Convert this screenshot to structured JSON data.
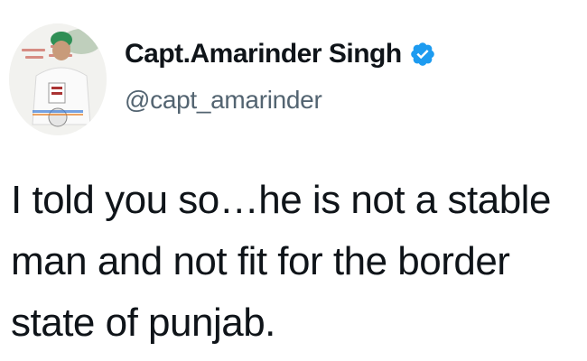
{
  "author": {
    "display_name": "Capt.Amarinder Singh",
    "handle": "@capt_amarinder",
    "verified": true,
    "verified_badge_icon": "verified-badge-icon",
    "badge_color": "#1d9bf0",
    "avatar_icon": "profile-avatar-icon"
  },
  "tweet": {
    "lines": [
      "I told you so…he is not a stable",
      "man and not fit for the border",
      "state of punjab."
    ]
  },
  "colors": {
    "text": "#0f1419",
    "secondary_text": "#536471",
    "background": "#ffffff"
  }
}
